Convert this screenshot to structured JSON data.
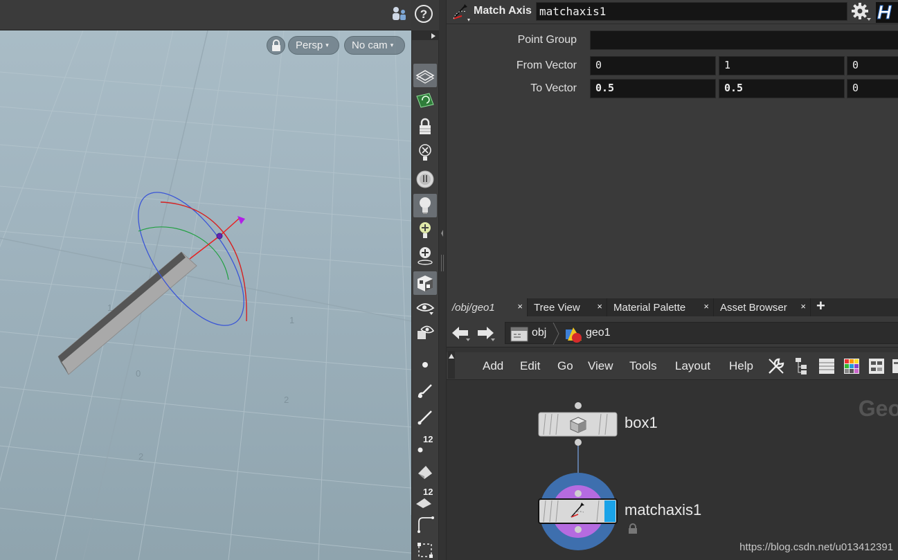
{
  "viewport": {
    "view_mode_label": "Persp",
    "camera_label": "No cam",
    "grid_numbers": [
      "1",
      "2",
      "0",
      "1",
      "2"
    ]
  },
  "toolbar_vertical": {
    "tools": [
      "display-options-icon",
      "snap-icon",
      "lock-icon",
      "ghost-icon",
      "headlight-icon",
      "light-icon",
      "light-add-icon",
      "light-place-icon",
      "shaded-icon",
      "visibility-icon",
      "visibility-2-icon",
      "point-icon",
      "brush-icon",
      "paint-icon",
      "point-numbers-icon",
      "prim-icon",
      "prim-numbers-icon",
      "edge-icon",
      "box-icon"
    ],
    "point_numbers_label": "12",
    "prim_numbers_label": "12"
  },
  "parameters": {
    "node_type": "Match Axis",
    "node_name": "matchaxis1",
    "point_group": {
      "label": "Point Group",
      "value": ""
    },
    "from_vector": {
      "label": "From Vector",
      "values": [
        "0",
        "1",
        "0"
      ]
    },
    "to_vector": {
      "label": "To Vector",
      "values": [
        "0.5",
        "0.5",
        "0"
      ]
    }
  },
  "network": {
    "tabs": [
      {
        "label": "/obj/geo1",
        "close": "×"
      },
      {
        "label": "Tree View",
        "close": "×"
      },
      {
        "label": "Material Palette",
        "close": "×"
      },
      {
        "label": "Asset Browser",
        "close": "×"
      }
    ],
    "add_tab": "+",
    "path": [
      "obj",
      "geo1"
    ],
    "menu": [
      "Add",
      "Edit",
      "Go",
      "View",
      "Tools",
      "Layout",
      "Help"
    ],
    "context_watermark": "Geo",
    "nodes": [
      {
        "name": "box1"
      },
      {
        "name": "matchaxis1"
      }
    ]
  },
  "watermark_url": "https://blog.csdn.net/u013412391",
  "colors": {
    "selected_node_ring": "#3e6fae",
    "display_flag": "#1aa3e8",
    "node_body": "#d9d9d9"
  }
}
